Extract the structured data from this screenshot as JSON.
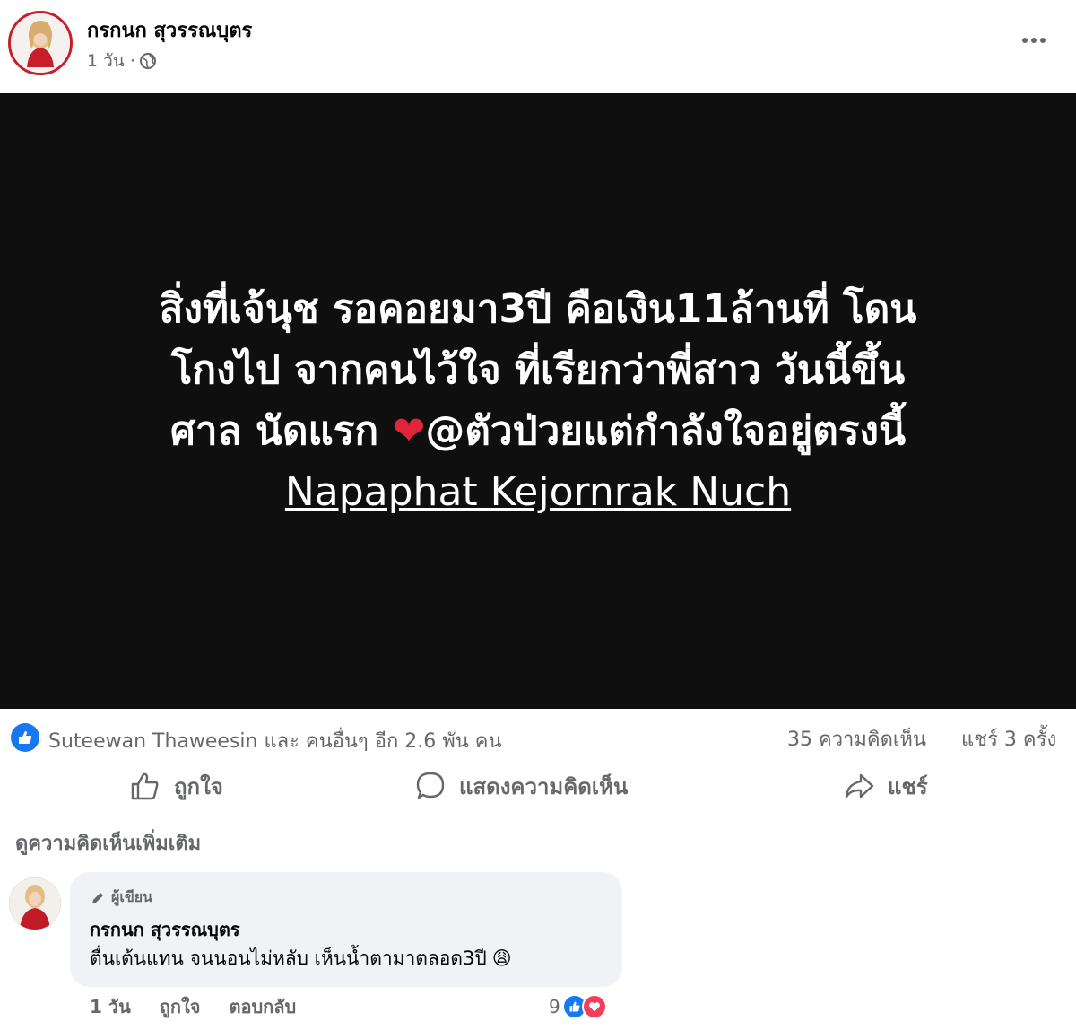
{
  "post": {
    "author": "กรกนก สุวรรณบุตร",
    "time": "1 วัน ·",
    "privacy_icon": "globe-icon",
    "image_text_lines": [
      "สิ่งที่เจ้นุช รอคอยมา3ปี คือเงิน11ล้านที่ โดน",
      "โกงไป จากคนไว้ใจ ที่เรียกว่าพี่สาว วันนี้ขึ้น",
      "ศาล นัดแรก ",
      "@ตัวป่วยแต่กำลังใจอยู่ตรงนี้"
    ],
    "heart": "❤",
    "tagged_name": "Napaphat Kejornrak Nuch"
  },
  "stats": {
    "likes_text": "Suteewan Thaweesin และ คนอื่นๆ อีก 2.6 พัน คน",
    "comments": "35 ความคิดเห็น",
    "shares": "แชร์ 3 ครั้ง"
  },
  "actions": {
    "like": "ถูกใจ",
    "comment": "แสดงความคิดเห็น",
    "share": "แชร์"
  },
  "more_comments": "ดูความคิดเห็นเพิ่มเติม",
  "comment": {
    "badge": "ผู้เขียน",
    "author": "กรกนก สุวรรณบุตร",
    "text": "ตื่นเต้นแทน จนนอนไม่หลับ เห็นน้ำตามาตลอด3ปี",
    "emoji": "😩",
    "time": "1 วัน",
    "like": "ถูกใจ",
    "reply": "ตอบกลับ",
    "reaction_count": "9"
  },
  "colors": {
    "accent": "#1877f2",
    "love": "#f33e58",
    "image_bg": "#0f0f0f",
    "muted": "#65676b"
  }
}
